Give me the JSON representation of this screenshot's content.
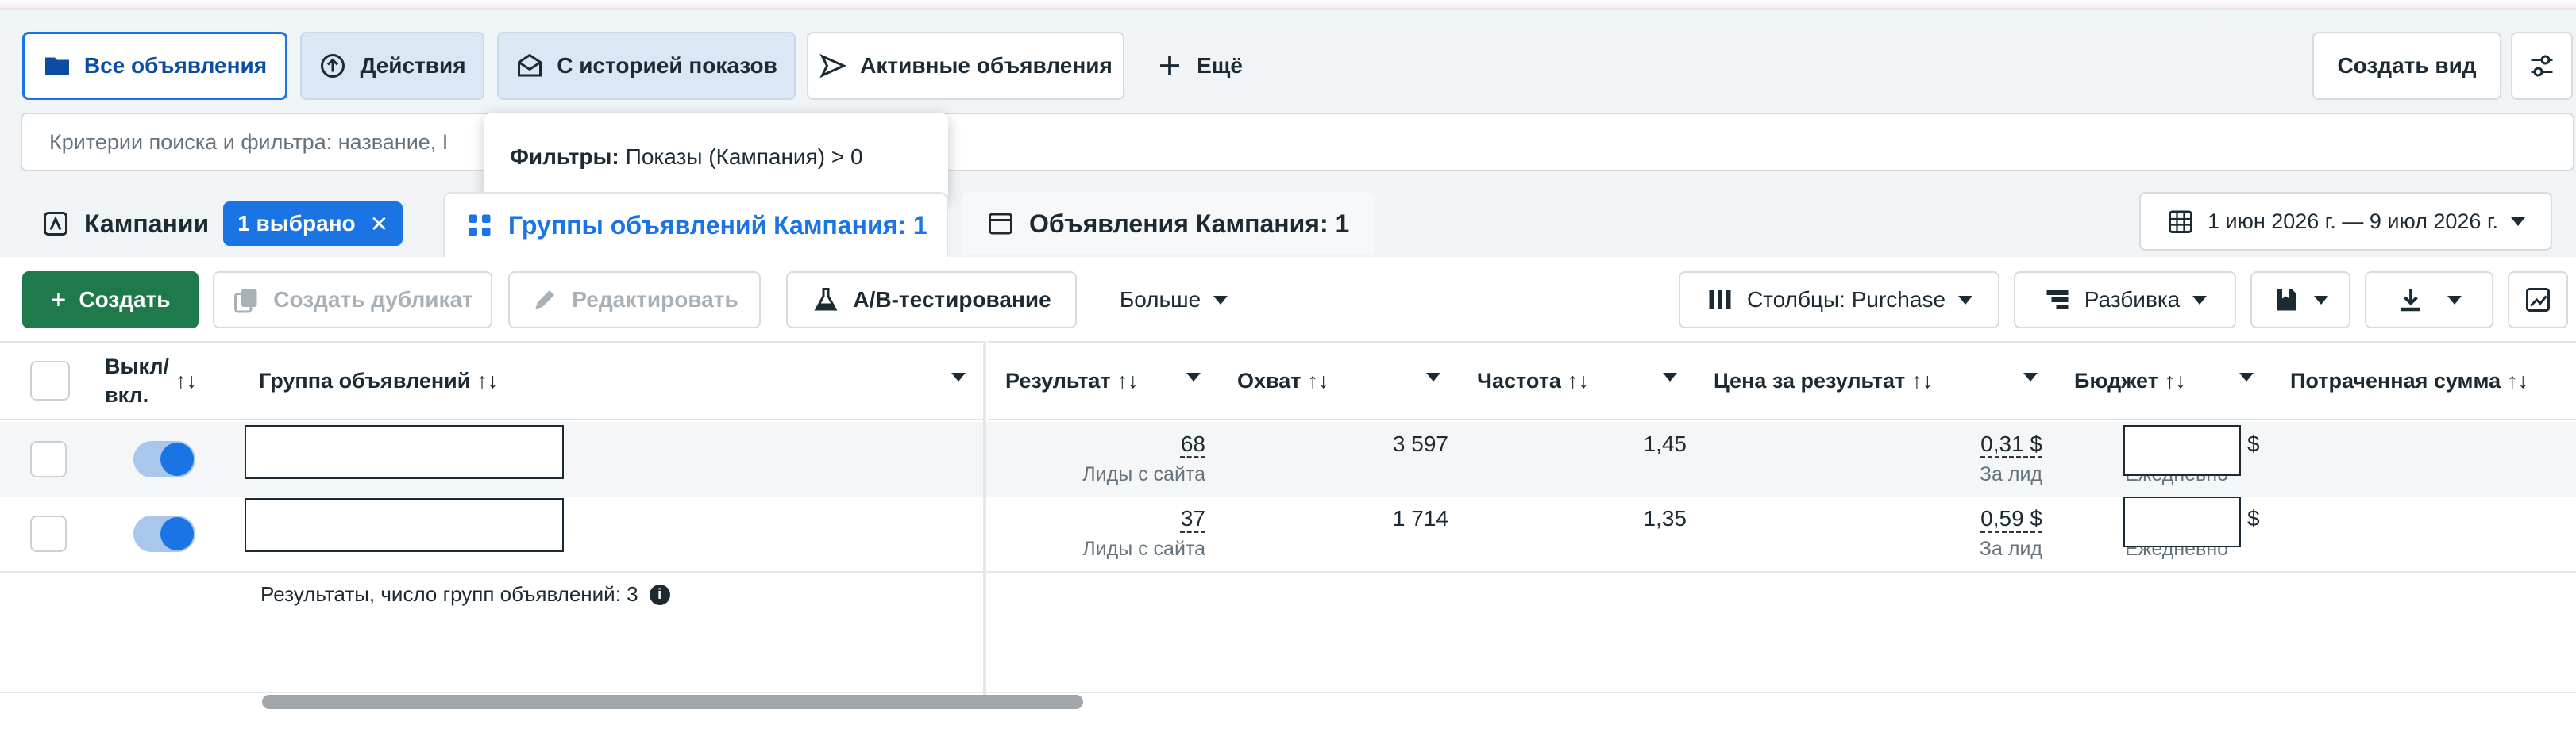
{
  "views": {
    "all_ads": "Все объявления",
    "actions": "Действия",
    "with_history": "С историей показов",
    "active_ads": "Активные объявления",
    "more": "Ещё",
    "create_view": "Создать вид"
  },
  "search": {
    "placeholder": "Критерии поиска и фильтра: название, I"
  },
  "tooltip": {
    "label": "Фильтры:",
    "value": "Показы (Кампания) > 0"
  },
  "tabs": {
    "campaigns": "Кампании",
    "selected_badge": "1 выбрано",
    "adsets": "Группы объявлений Кампания: 1",
    "ads": "Объявления Кампания: 1"
  },
  "date_range": "1 июн 2026 г. — 9 июл 2026 г.",
  "toolbar": {
    "create": "Создать",
    "duplicate": "Создать дубликат",
    "edit": "Редактировать",
    "ab_test": "A/B-тестирование",
    "more": "Больше",
    "columns": "Столбцы: Purchase",
    "breakdown": "Разбивка"
  },
  "columns": {
    "toggle": "Выкл/\nвкл.",
    "adset": "Группа объявлений",
    "result": "Результат",
    "reach": "Охват",
    "frequency": "Частота",
    "cost_per_result": "Цена за результат",
    "budget": "Бюджет",
    "spent": "Потраченная сумма"
  },
  "sort_icon": "↑↓",
  "rows": [
    {
      "result": "68",
      "result_type": "Лиды с сайта",
      "reach": "3 597",
      "frequency": "1,45",
      "cost": "0,31 $",
      "cost_type": "За лид",
      "budget_currency": "$",
      "budget_period": "Ежедневно",
      "toggle_on": true
    },
    {
      "result": "37",
      "result_type": "Лиды с сайта",
      "reach": "1 714",
      "frequency": "1,35",
      "cost": "0,59 $",
      "cost_type": "За лид",
      "budget_currency": "$",
      "budget_period": "Ежедневно",
      "toggle_on": true
    }
  ],
  "summary": "Результаты, число групп объявлений: 3",
  "colors": {
    "accent": "#1b74e4",
    "create_green": "#1f7a4b"
  }
}
